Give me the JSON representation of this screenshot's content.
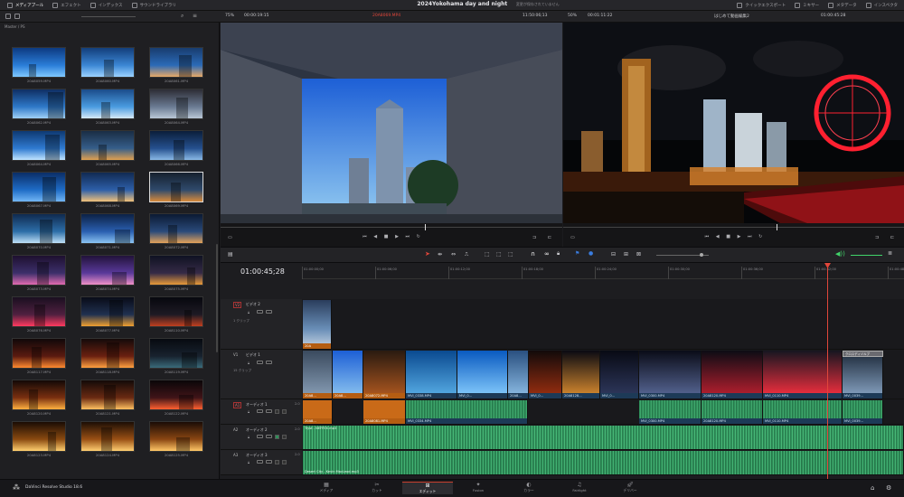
{
  "top_bar": {
    "tabs": [
      {
        "label": "メディアプール",
        "icon": "media-pool-icon",
        "active": true
      },
      {
        "label": "エフェクト",
        "icon": "effects-icon",
        "active": false
      },
      {
        "label": "インデックス",
        "icon": "index-icon",
        "active": false
      },
      {
        "label": "サウンドライブラリ",
        "icon": "sound-library-icon",
        "active": false
      }
    ],
    "project_title": "2024Yokohama day and night",
    "save_status": "変更が保存されていません",
    "right_tabs": [
      {
        "label": "クイックエクスポート",
        "icon": "export-icon"
      },
      {
        "label": "ミキサー",
        "icon": "mixer-icon"
      },
      {
        "label": "メタデータ",
        "icon": "metadata-icon"
      },
      {
        "label": "インスペクタ",
        "icon": "inspector-icon"
      }
    ]
  },
  "source_viewer": {
    "zoom": "75%",
    "timecode_left": "00:00:19:15",
    "clip_name": "20A8069.MP4",
    "timecode_right": "11:50:06;13"
  },
  "program_viewer": {
    "zoom": "50%",
    "timecode_left": "00:01:11:22",
    "timeline_name": "はじめて動画編集2",
    "timecode_right": "01:00:45:28"
  },
  "bin": {
    "path": "Master / PS",
    "clips": [
      "20A8059.MP4",
      "20A8060.MP4",
      "20A8061.MP4",
      "20A8062.MP4",
      "20A8063.MP4",
      "20A8064.MP4",
      "20A8064.MP4",
      "20A8065.MP4",
      "20A8066.MP4",
      "20A8067.MP4",
      "20A8068.MP4",
      "20A8069.MP4",
      "20A8070.MP4",
      "20A8071.MP4",
      "20A8072.MP4",
      "20A8073.MP4",
      "20A8074.MP4",
      "20A8075.MP4",
      "20A8076.MP4",
      "20A8077.MP4",
      "20A8110.MP4",
      "20A8117.MP4",
      "20A8118.MP4",
      "20A8119.MP4",
      "20A8120.MP4",
      "20A8121.MP4",
      "20A8122.MP4",
      "20A8123.MP4",
      "20A8124.MP4",
      "20A8125.MP4",
      "20A8126.MP4",
      "20A8127.MP4",
      "20A8128.MP4"
    ]
  },
  "timeline": {
    "timecode": "01:00:45;28",
    "ruler": [
      "01:00:00;00",
      "01:00:06;00",
      "01:00:12;00",
      "01:00:18;00",
      "01:00:24;00",
      "01:00:30;00",
      "01:00:36;00",
      "01:00:42;00",
      "01:00:48;00"
    ],
    "tracks": [
      {
        "id": "V2",
        "name": "ビデオ 2",
        "info": "1 クリップ"
      },
      {
        "id": "V1",
        "name": "ビデオ 1",
        "info": "15 クリップ"
      },
      {
        "id": "A1",
        "name": "オーディオ 1",
        "level": "2.0"
      },
      {
        "id": "A2",
        "name": "オーディオ 2",
        "level": "2.0"
      },
      {
        "id": "A3",
        "name": "オーディオ 3",
        "level": "2.0"
      }
    ],
    "v2_clip": "20A",
    "v1_clips": [
      "20A8...",
      "20A8...",
      "20A8072.MP4",
      "MVI_0338.MP4",
      "MVI_0...",
      "20A8...",
      "MVI_0...",
      "20A8128...",
      "MVI_0...",
      "MVI_0300.MP4",
      "20A8120.MP4",
      "MVI_0110.MP4",
      "MVI_0039..."
    ],
    "title_clip": "クロスディゾルブ",
    "a1_clips": [
      "20A8...",
      "20A8081.MP4",
      "MVI_0334.MP4",
      "MVI_0300.MP4",
      "20A8120.MP4",
      "MVI_0110.MP4",
      "MVI_0039..."
    ],
    "a2_clip": "Tryst - NEFFEX.mp3",
    "a3_clip": "Desert City - Kevin MacLeod.mp3"
  },
  "app": {
    "name": "DaVinci Resolve Studio 18.6"
  },
  "pages": [
    {
      "label": "メディア",
      "icon": "media-page-icon"
    },
    {
      "label": "カット",
      "icon": "cut-page-icon"
    },
    {
      "label": "エディット",
      "icon": "edit-page-icon",
      "active": true
    },
    {
      "label": "Fusion",
      "icon": "fusion-page-icon"
    },
    {
      "label": "カラー",
      "icon": "color-page-icon"
    },
    {
      "label": "Fairlight",
      "icon": "fairlight-page-icon"
    },
    {
      "label": "デリバー",
      "icon": "deliver-page-icon"
    }
  ],
  "colors": {
    "accent": "#e0463a",
    "clip_blue": "#1d3a57",
    "clip_orange": "#b55d12",
    "audio_green": "#2f8f5a"
  }
}
